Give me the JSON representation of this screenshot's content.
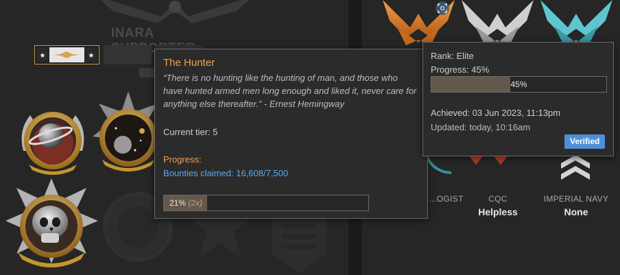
{
  "supporter": {
    "label": "INARA SUPPORTER"
  },
  "ranks": [
    {
      "label": "...OGIST",
      "value": ""
    },
    {
      "label": "CQC",
      "value": "Helpless"
    },
    {
      "label": "IMPERIAL NAVY",
      "value": "None"
    }
  ],
  "hunter_tooltip": {
    "title": "The Hunter",
    "quote": "“There is no hunting like the hunting of man, and those who have hunted armed men long enough and liked it, never care for anything else thereafter.” - Ernest Hemingway",
    "tier": "Current tier: 5",
    "progress_label": "Progress:",
    "bounties": "Bounties claimed: 16,608/7,500",
    "bar_percent": "21%",
    "bar_multiplier": "(2x)",
    "bar_fraction": 0.21
  },
  "rank_tooltip": {
    "rank": "Rank: Elite",
    "progress": "Progress: 45%",
    "bar_label": "45%",
    "bar_fraction": 0.45,
    "achieved": "Achieved: 03 Jun 2023, 11:13pm",
    "updated": "Updated: today, 10:16am",
    "verified_label": "Verified"
  },
  "icons": {
    "snapshot": "camera-focus-icon",
    "medals": [
      "planet-medal-icon",
      "star-system-medal-icon",
      "skull-medal-icon"
    ]
  },
  "colors": {
    "accent_orange": "#f0a24e",
    "link_blue": "#5aa9f0",
    "verified_blue": "#4f8fd6",
    "bar_fill": "#64584d"
  }
}
